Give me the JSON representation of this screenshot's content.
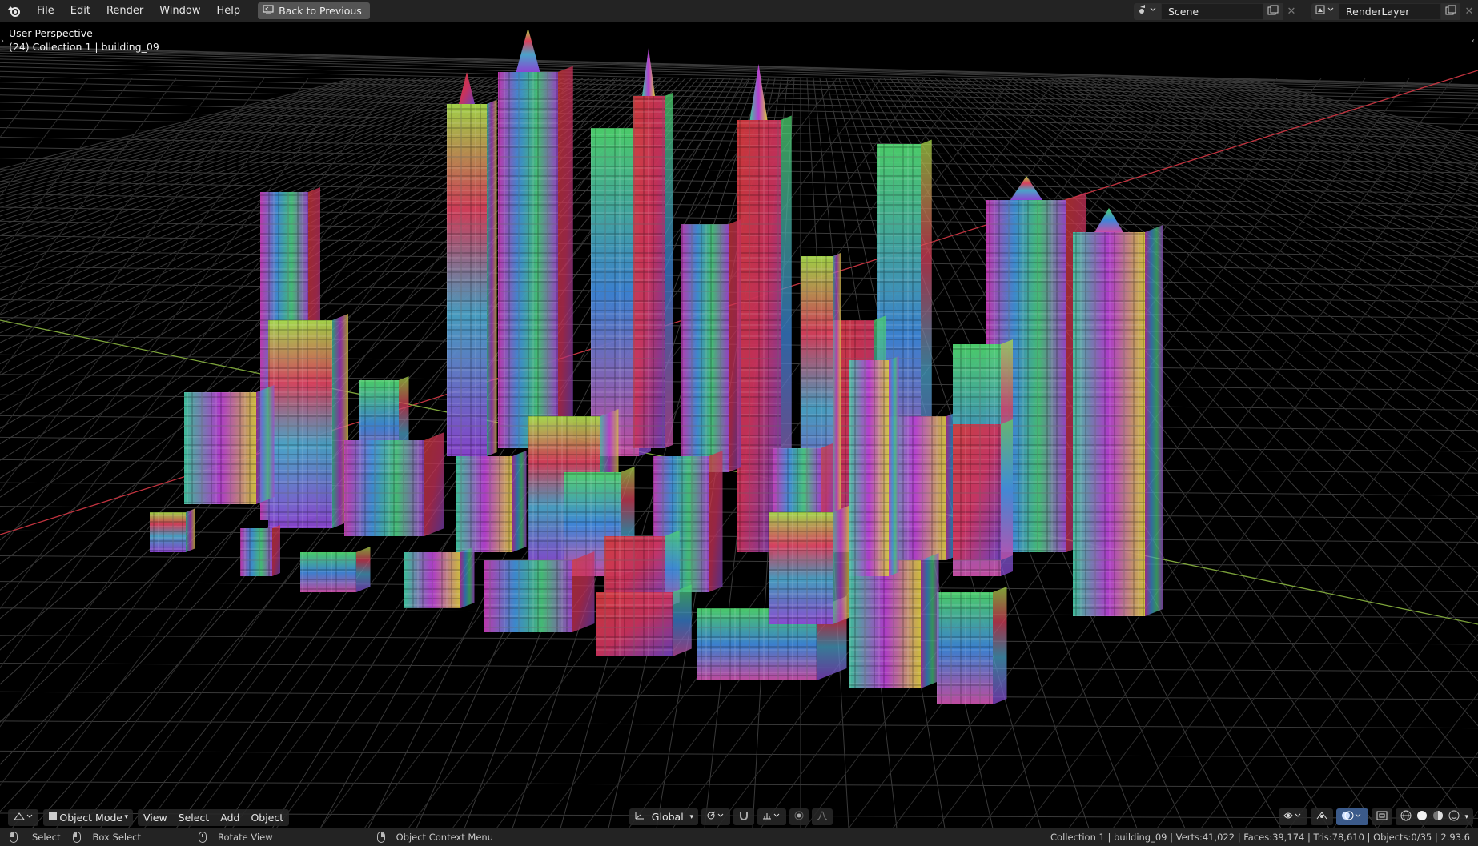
{
  "topbar": {
    "menu": [
      "File",
      "Edit",
      "Render",
      "Window",
      "Help"
    ],
    "back_label": "Back to Previous",
    "scene_name": "Scene",
    "render_layer": "RenderLayer"
  },
  "viewport": {
    "view_name": "User Perspective",
    "collection_label": "(24) Collection 1 | building_09"
  },
  "toolbar": {
    "mode": "Object Mode",
    "view": "View",
    "select": "Select",
    "add": "Add",
    "object": "Object",
    "orientation": "Global"
  },
  "status": {
    "select": "Select",
    "box_select": "Box Select",
    "rotate_view": "Rotate View",
    "context_menu": "Object Context Menu",
    "stats": "Collection 1 | building_09 | Verts:41,022 | Faces:39,174 | Tris:78,610 | Objects:0/35 | 2.93.6"
  },
  "colors": {
    "header_bg": "#232323",
    "viewport_bg": "#000000",
    "grid": "#3a3a3a",
    "x_axis": "#c2333f",
    "y_axis": "#7ca33a",
    "accent": "#4772b3"
  }
}
